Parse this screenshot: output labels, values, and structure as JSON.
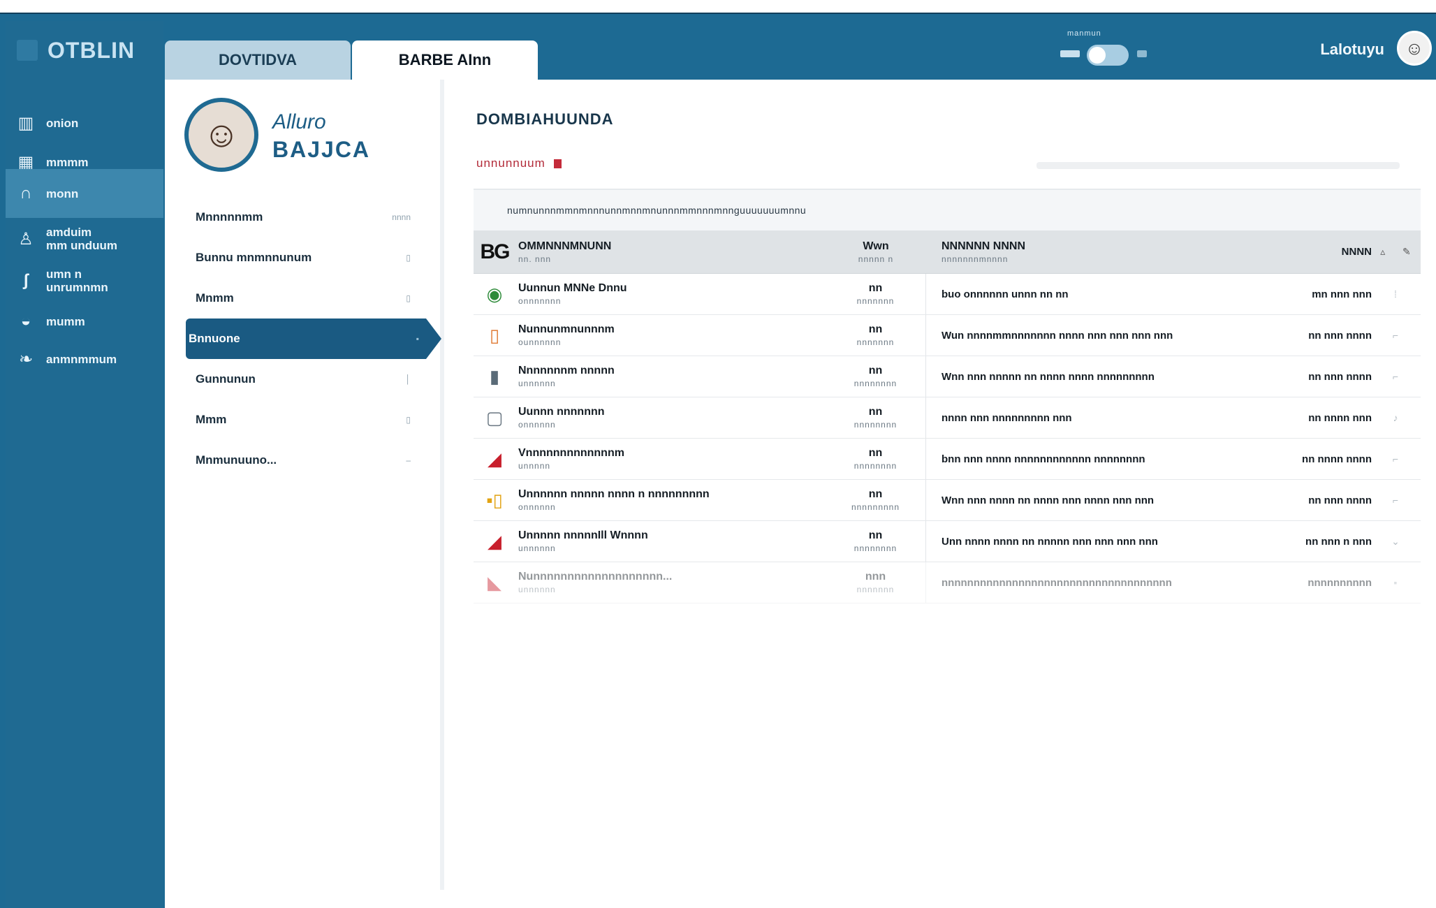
{
  "app": {
    "brand": "OTBLIN"
  },
  "sidebar": {
    "items": [
      {
        "label": "onion",
        "icon": "book-icon"
      },
      {
        "label": "mmmm",
        "icon": "image-icon"
      },
      {
        "label": "monn",
        "icon": "arc-icon"
      },
      {
        "label": "amduim\nmm unduum",
        "icon": "person-icon"
      },
      {
        "label": "umn n\nunrumnmn",
        "icon": "hook-icon"
      },
      {
        "label": "mumm",
        "icon": "cup-icon"
      },
      {
        "label": "anmnmmum",
        "icon": "leaf-icon"
      }
    ],
    "active_index": 2
  },
  "topbar": {
    "tabs": [
      "DOVTIDVA",
      "BARBE AInn"
    ],
    "active_tab": 1,
    "toggle_label": "manmun",
    "user_name": "Lalotuyu"
  },
  "profile": {
    "first_name": "Alluro",
    "last_name": "BAJJCA",
    "menu": [
      {
        "label": "Mnnnnnmm",
        "right": "nnnn"
      },
      {
        "label": "Bunnu mnmnnunum",
        "right": "▯"
      },
      {
        "label": "Mnmm",
        "right": "▯"
      },
      {
        "label": "Bnnuone",
        "right": "▪"
      },
      {
        "label": "Gunnunun",
        "right": "│"
      },
      {
        "label": "Mmm",
        "right": "▯"
      },
      {
        "label": "Mnmunuuno...",
        "right": "–"
      }
    ],
    "active_index": 3
  },
  "list": {
    "title": "DOMBIAHUUNDA",
    "subtitle": "unnunnuum",
    "filter_text": "numnunnnmmnmnnnunnmnnmnunnnmmnnnmnnguuuuuuumnnu",
    "header": {
      "icon": "BG",
      "name": "OMMNNNMNUNN",
      "name_sub": "nn. nnn",
      "size": "Wwn",
      "size_sub": "nnnnn n",
      "desc": "NNNNNN NNNN",
      "desc_sub": "nnnnnnnmnnnn",
      "date": "NNNN",
      "act1": "▵",
      "act2": "✎"
    },
    "rows": [
      {
        "icon": "globe-icon",
        "icon_glyph": "◉",
        "color": "#2e8b3a",
        "name": "Uunnun MNNe Dnnu",
        "sub": "onnnnnnn",
        "size": "nn",
        "size_sub": "nnnnnnn",
        "desc": "buo onnnnnn unnn nn nn",
        "date": "mn nnn nnn",
        "act": "⁞"
      },
      {
        "icon": "document-icon",
        "icon_glyph": "▯",
        "color": "#e07b35",
        "name": "Nunnunmnunnnm",
        "sub": "ounnnnnn",
        "size": "nn",
        "size_sub": "nnnnnnn",
        "desc": "Wun nnnnmmnnnnnnn nnnn nnn nnn nnn nnn",
        "date": "nn nnn nnnn",
        "act": "⌐"
      },
      {
        "icon": "file-icon",
        "icon_glyph": "▮",
        "color": "#5a6b78",
        "name": "Nnnnnnnm nnnnn",
        "sub": "unnnnnn",
        "size": "nn",
        "size_sub": "nnnnnnnn",
        "desc": "Wnn nnn nnnnn nn nnnn nnnn nnnnnnnnn",
        "date": "nn nnn nnnn",
        "act": "⌐"
      },
      {
        "icon": "box-icon",
        "icon_glyph": "▢",
        "color": "#6a7782",
        "name": "Uunnn nnnnnnn",
        "sub": "onnnnnn",
        "size": "nn",
        "size_sub": "nnnnnnnn",
        "desc": "nnnn nnn nnnnnnnnn nnn",
        "date": "nn nnnn nnn",
        "act": "♪"
      },
      {
        "icon": "shape-icon",
        "icon_glyph": "◢",
        "color": "#c8202d",
        "name": "Vnnnnnnnnnnnnnm",
        "sub": "unnnnn",
        "size": "nn",
        "size_sub": "nnnnnnnn",
        "desc": "bnn nnn nnnn nnnnnnnnnnnn nnnnnnnn",
        "date": "nn nnnn nnnn",
        "act": "⌐"
      },
      {
        "icon": "chart-icon",
        "icon_glyph": "▪▯",
        "color": "#e2a312",
        "name": "Unnnnnn nnnnn nnnn n nnnnnnnnn",
        "sub": "onnnnnn",
        "size": "nn",
        "size_sub": "nnnnnnnnn",
        "desc": "Wnn nnn nnnn nn nnnn nnn nnnn nnn nnn",
        "date": "nn nnn nnnn",
        "act": "⌐"
      },
      {
        "icon": "shape-icon",
        "icon_glyph": "◢",
        "color": "#c8202d",
        "name": "Unnnnn nnnnnIll Wnnnn",
        "sub": "unnnnnn",
        "size": "nn",
        "size_sub": "nnnnnnnn",
        "desc": "Unn nnnn nnnn nn nnnnn nnn nnn nnn nnn",
        "date": "nn nnn n nnn",
        "act": "⌄"
      },
      {
        "icon": "shoe-icon",
        "icon_glyph": "◣",
        "color": "#c8202d",
        "name": "Nunnnnnnnnnnnnnnnnnnn...",
        "sub": "unnnnnn",
        "size": "nnn",
        "size_sub": "nnnnnnn",
        "desc": "nnnnnnnnnnnnnnnnnnnnnnnnnnnnnnnnnnnn",
        "date": "nnnnnnnnnn",
        "act": "▪"
      }
    ]
  }
}
